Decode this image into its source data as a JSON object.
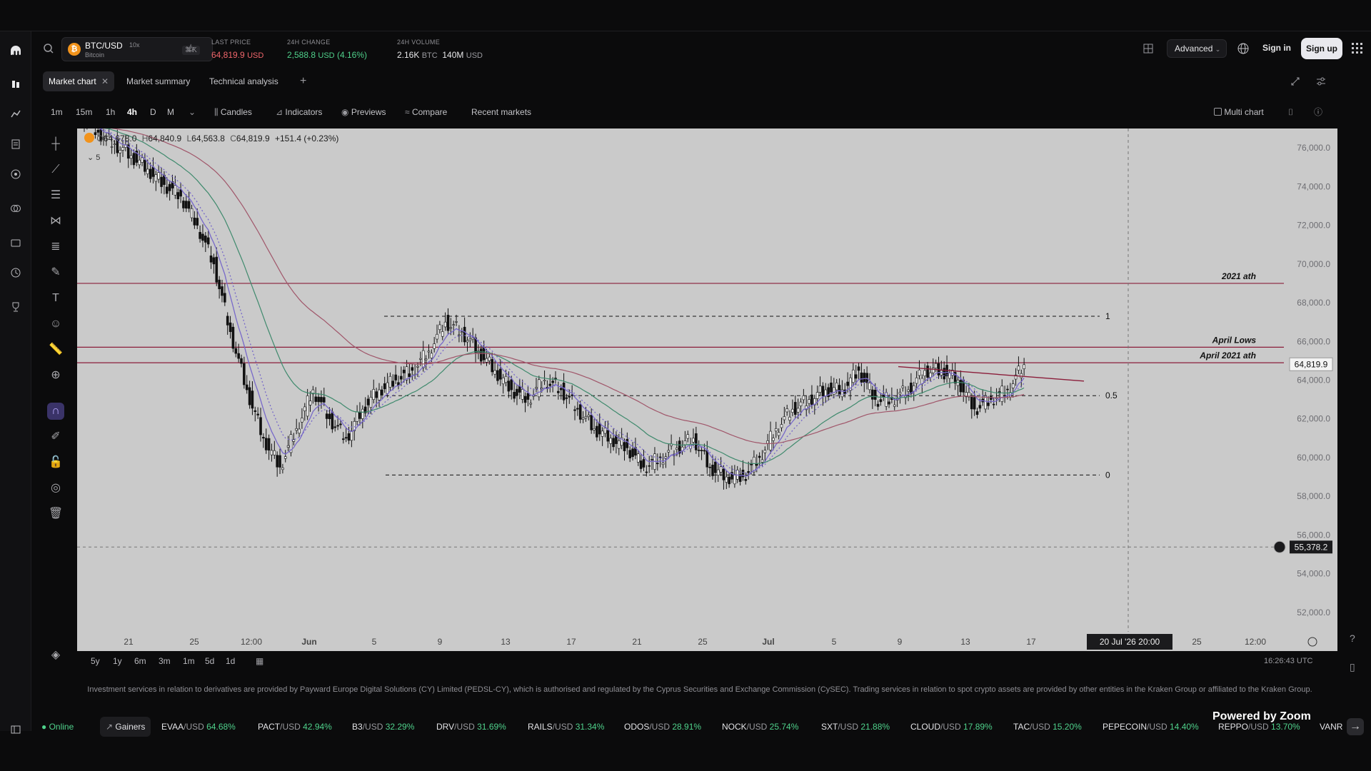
{
  "header": {
    "pair": "BTC/USD",
    "leverage": "10x",
    "asset_name": "Bitcoin",
    "shortcut": "⌘K",
    "last_price_label": "LAST PRICE",
    "last_price": "64,819.9",
    "last_price_ccy": "USD",
    "change_label": "24H CHANGE",
    "change_value": "2,588.8",
    "change_ccy": "USD",
    "change_pct": "(4.16%)",
    "volume_label": "24H VOLUME",
    "volume_btc": "2.16K",
    "volume_btc_ccy": "BTC",
    "volume_usd": "140M",
    "volume_usd_ccy": "USD",
    "mode": "Advanced",
    "sign_in": "Sign in",
    "sign_up": "Sign up"
  },
  "tabs": [
    {
      "label": "Market chart",
      "active": true
    },
    {
      "label": "Market summary"
    },
    {
      "label": "Technical analysis"
    }
  ],
  "toolbar": {
    "timeframes": [
      "1m",
      "15m",
      "1h",
      "4h",
      "D",
      "M"
    ],
    "active_timeframe": "4h",
    "candles": "Candles",
    "indicators": "Indicators",
    "previews": "Previews",
    "compare": "Compare",
    "recent": "Recent markets",
    "multichart": "Multi chart"
  },
  "chart": {
    "legend": {
      "open": "64,678.0",
      "high": "64,840.9",
      "low": "64,563.8",
      "close": "64,819.9",
      "change": "+151.4 (+0.23%)",
      "count": "5"
    },
    "price_ticks": [
      "76,000.0",
      "74,000.0",
      "72,000.0",
      "70,000.0",
      "68,000.0",
      "66,000.0",
      "64,000.0",
      "62,000.0",
      "60,000.0",
      "58,000.0",
      "56,000.0",
      "54,000.0",
      "52,000.0"
    ],
    "current_price_tag": "64,819.9",
    "crosshair_price_tag": "55,378.2",
    "crosshair_date_tag": "20 Jul '26   20:00",
    "date_ticks": [
      "21",
      "25",
      "12:00",
      "Jun",
      "5",
      "9",
      "13",
      "17",
      "21",
      "25",
      "Jul",
      "5",
      "9",
      "13",
      "17",
      "25",
      "12:00"
    ],
    "annotations": {
      "ath_2021": "2021 ath",
      "april_lows": "April Lows",
      "april_2021_ath": "April 2021 ath",
      "fib_1": "1",
      "fib_05": "0.5",
      "fib_0": "0"
    }
  },
  "chart_data": {
    "type": "line",
    "title": "",
    "xlabel": "",
    "ylabel": "",
    "ylim": [
      51000,
      77000
    ],
    "horizontal_levels": [
      {
        "name": "2021 ath",
        "value": 69000
      },
      {
        "name": "April Lows",
        "value": 65700
      },
      {
        "name": "April 2021 ath",
        "value": 64900
      }
    ],
    "fib_levels": [
      {
        "name": "1",
        "value": 67300
      },
      {
        "name": "0.5",
        "value": 63200
      },
      {
        "name": "0",
        "value": 59100
      }
    ],
    "series": [
      {
        "values": [
          77500,
          76800,
          76200,
          75600,
          74900,
          74100,
          73500,
          72000,
          70000,
          66500,
          63500,
          61000,
          59500,
          61500,
          63500,
          62000,
          61000,
          62500,
          63500,
          64000,
          64500,
          65500,
          67000,
          66500,
          65500,
          64500,
          63500,
          63000,
          64000,
          63500,
          62500,
          61500,
          61000,
          60500,
          59500,
          60000,
          60500,
          61000,
          59500,
          59000,
          59000,
          60000,
          61500,
          62500,
          63000,
          63500,
          63500,
          64500,
          63000,
          63000,
          63500,
          64500,
          64500,
          64000,
          62500,
          63000,
          63500,
          64800
        ]
      }
    ]
  },
  "bottom": {
    "ranges": [
      "5y",
      "1y",
      "6m",
      "3m",
      "1m",
      "5d",
      "1d"
    ],
    "clock": "16:26:43 UTC"
  },
  "disclaimer": "Investment services in relation to derivatives are provided by Payward Europe Digital Solutions (CY) Limited (PEDSL-CY), which is authorised and regulated by the Cyprus Securities and Exchange Commission (CySEC). Trading services in relation to spot crypto assets are provided by other entities in the Kraken Group or affiliated to the Kraken Group.",
  "ticker": {
    "status": "Online",
    "gainers": "Gainers",
    "items": [
      {
        "sym": "EVAA",
        "quote": "/USD",
        "pct": "64.68%"
      },
      {
        "sym": "PACT",
        "quote": "/USD",
        "pct": "42.94%"
      },
      {
        "sym": "B3",
        "quote": "/USD",
        "pct": "32.29%"
      },
      {
        "sym": "DRV",
        "quote": "/USD",
        "pct": "31.69%"
      },
      {
        "sym": "RAILS",
        "quote": "/USD",
        "pct": "31.34%"
      },
      {
        "sym": "ODOS",
        "quote": "/USD",
        "pct": "28.91%"
      },
      {
        "sym": "NOCK",
        "quote": "/USD",
        "pct": "25.74%"
      },
      {
        "sym": "SXT",
        "quote": "/USD",
        "pct": "21.88%"
      },
      {
        "sym": "CLOUD",
        "quote": "/USD",
        "pct": "17.89%"
      },
      {
        "sym": "TAC",
        "quote": "/USD",
        "pct": "15.20%"
      },
      {
        "sym": "PEPECOIN",
        "quote": "/USD",
        "pct": "14.40%"
      },
      {
        "sym": "REPPO",
        "quote": "/USD",
        "pct": "13.70%"
      }
    ],
    "trailing": "VANR",
    "watermark": "Powered by Zoom"
  },
  "colors": {
    "accent": "#7b61ff",
    "up": "#4fd18b",
    "down": "#f0666b",
    "level_line": "#8b1d3a",
    "ema_purple": "#7768c9",
    "ema_green": "#3f8a6d",
    "ema_red": "#a0566a"
  }
}
